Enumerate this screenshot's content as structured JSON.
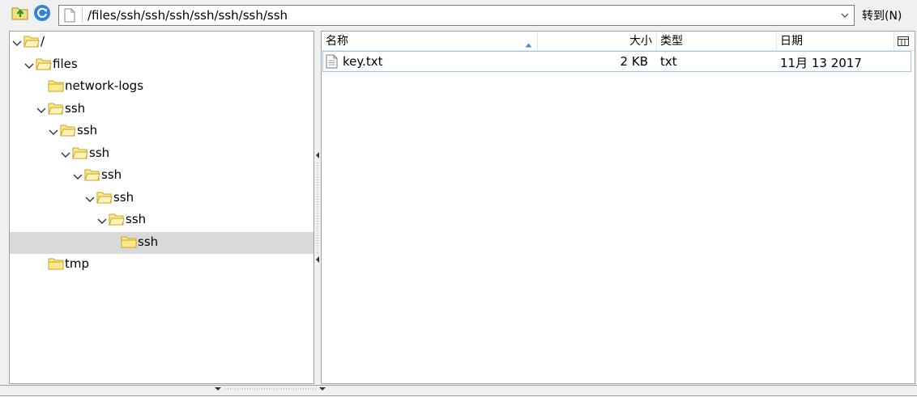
{
  "toolbar": {
    "up_icon": "folder-up-icon",
    "refresh_icon": "refresh-icon",
    "address_icon": "document-icon",
    "path": "/files/ssh/ssh/ssh/ssh/ssh/ssh/ssh",
    "goto_label": "转到(N)"
  },
  "tree": {
    "items": [
      {
        "label": "/",
        "expanded": true
      },
      {
        "label": "files",
        "expanded": true
      },
      {
        "label": "network-logs",
        "expanded": false
      },
      {
        "label": "ssh",
        "expanded": true
      },
      {
        "label": "ssh",
        "expanded": true
      },
      {
        "label": "ssh",
        "expanded": true
      },
      {
        "label": "ssh",
        "expanded": true
      },
      {
        "label": "ssh",
        "expanded": true
      },
      {
        "label": "ssh",
        "expanded": true
      },
      {
        "label": "ssh",
        "expanded": false,
        "selected": true
      },
      {
        "label": "tmp",
        "expanded": false
      }
    ]
  },
  "list": {
    "columns": {
      "name": "名称",
      "size": "大小",
      "type": "类型",
      "date": "日期"
    },
    "sort_column": "name",
    "files": [
      {
        "name": "key.txt",
        "size": "2 KB",
        "type": "txt",
        "date": "11月 13 2017",
        "icon": "text-file-icon"
      }
    ]
  },
  "colors": {
    "folder_fill": "#ffe98a",
    "folder_stroke": "#c9a227",
    "selection": "#d9d9d9",
    "row_focus_border": "#99c9ef"
  }
}
